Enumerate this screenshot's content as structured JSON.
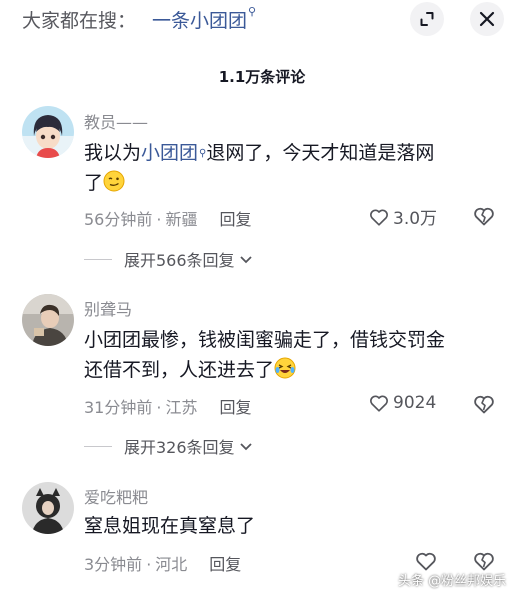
{
  "search": {
    "prefix": "大家都在搜：",
    "query": "一条小团团",
    "query_icon": "search-small-icon"
  },
  "header": {
    "comment_count": "1.1万条评论"
  },
  "comments": [
    {
      "author": "教员——",
      "text_before": "我以为",
      "keyword": "小团团",
      "text_after": "退网了，今天才知道是落网",
      "text_line2": "了",
      "emoji": "wry-smile-emoji",
      "time": "56分钟前",
      "location": "新疆",
      "reply": "回复",
      "likes": "3.0万",
      "expand_replies": "展开566条回复"
    },
    {
      "author": "别聋马",
      "text_line1": "小团团最惨，钱被闺蜜骗走了，借钱交罚金",
      "text_line2": "还借不到，人还进去了",
      "emoji": "laughing-tears-emoji",
      "time": "31分钟前",
      "location": "江苏",
      "reply": "回复",
      "likes": "9024",
      "expand_replies": "展开326条回复"
    },
    {
      "author": "爱吃粑粑",
      "text_line1": "窒息姐现在真窒息了",
      "time": "3分钟前",
      "location": "河北",
      "reply": "回复"
    }
  ],
  "separator": "·",
  "watermark": "头条 @粉丝邦娱乐",
  "colors": {
    "link_blue": "#3b5998",
    "secondary_text": "#8a8b91",
    "primary_text": "#161823"
  }
}
